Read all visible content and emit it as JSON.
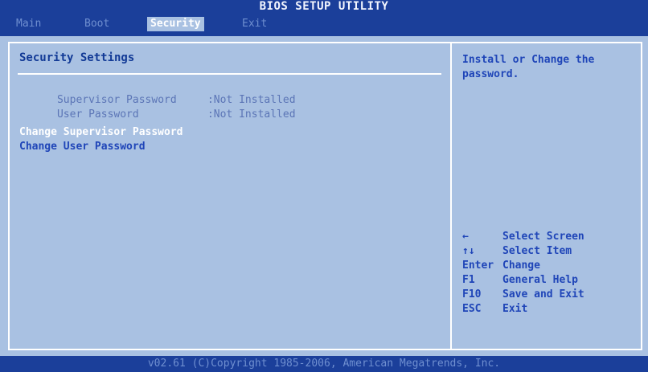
{
  "window": {
    "title": "BIOS SETUP UTILITY"
  },
  "menu": {
    "items": [
      {
        "label": "Main"
      },
      {
        "label": "Boot"
      },
      {
        "label": "Security"
      },
      {
        "label": "Exit"
      }
    ],
    "active": "Security"
  },
  "main": {
    "section_title": "Security Settings",
    "supervisor_password": {
      "label": "Supervisor Password",
      "value": ":Not Installed"
    },
    "user_password": {
      "label": "User Password",
      "value": ":Not Installed"
    },
    "options": [
      {
        "label": "Change Supervisor Password"
      },
      {
        "label": "Change User Password"
      }
    ]
  },
  "help": {
    "text": "Install or Change the password.",
    "keys": [
      {
        "key": "←",
        "action": "Select Screen"
      },
      {
        "key": "↑↓",
        "action": "Select Item"
      },
      {
        "key": "Enter",
        "action": "Change"
      },
      {
        "key": "F1",
        "action": "General Help"
      },
      {
        "key": "F10",
        "action": "Save and Exit"
      },
      {
        "key": "ESC",
        "action": "Exit"
      }
    ]
  },
  "footer": {
    "text": "v02.61 (C)Copyright 1985-2006, American Megatrends, Inc."
  },
  "colors": {
    "background": "#a9c1e2",
    "bar": "#1b3f9a",
    "highlight": "#ffffff",
    "text": "#1f45b8",
    "dim_text": "#5b75b6"
  }
}
